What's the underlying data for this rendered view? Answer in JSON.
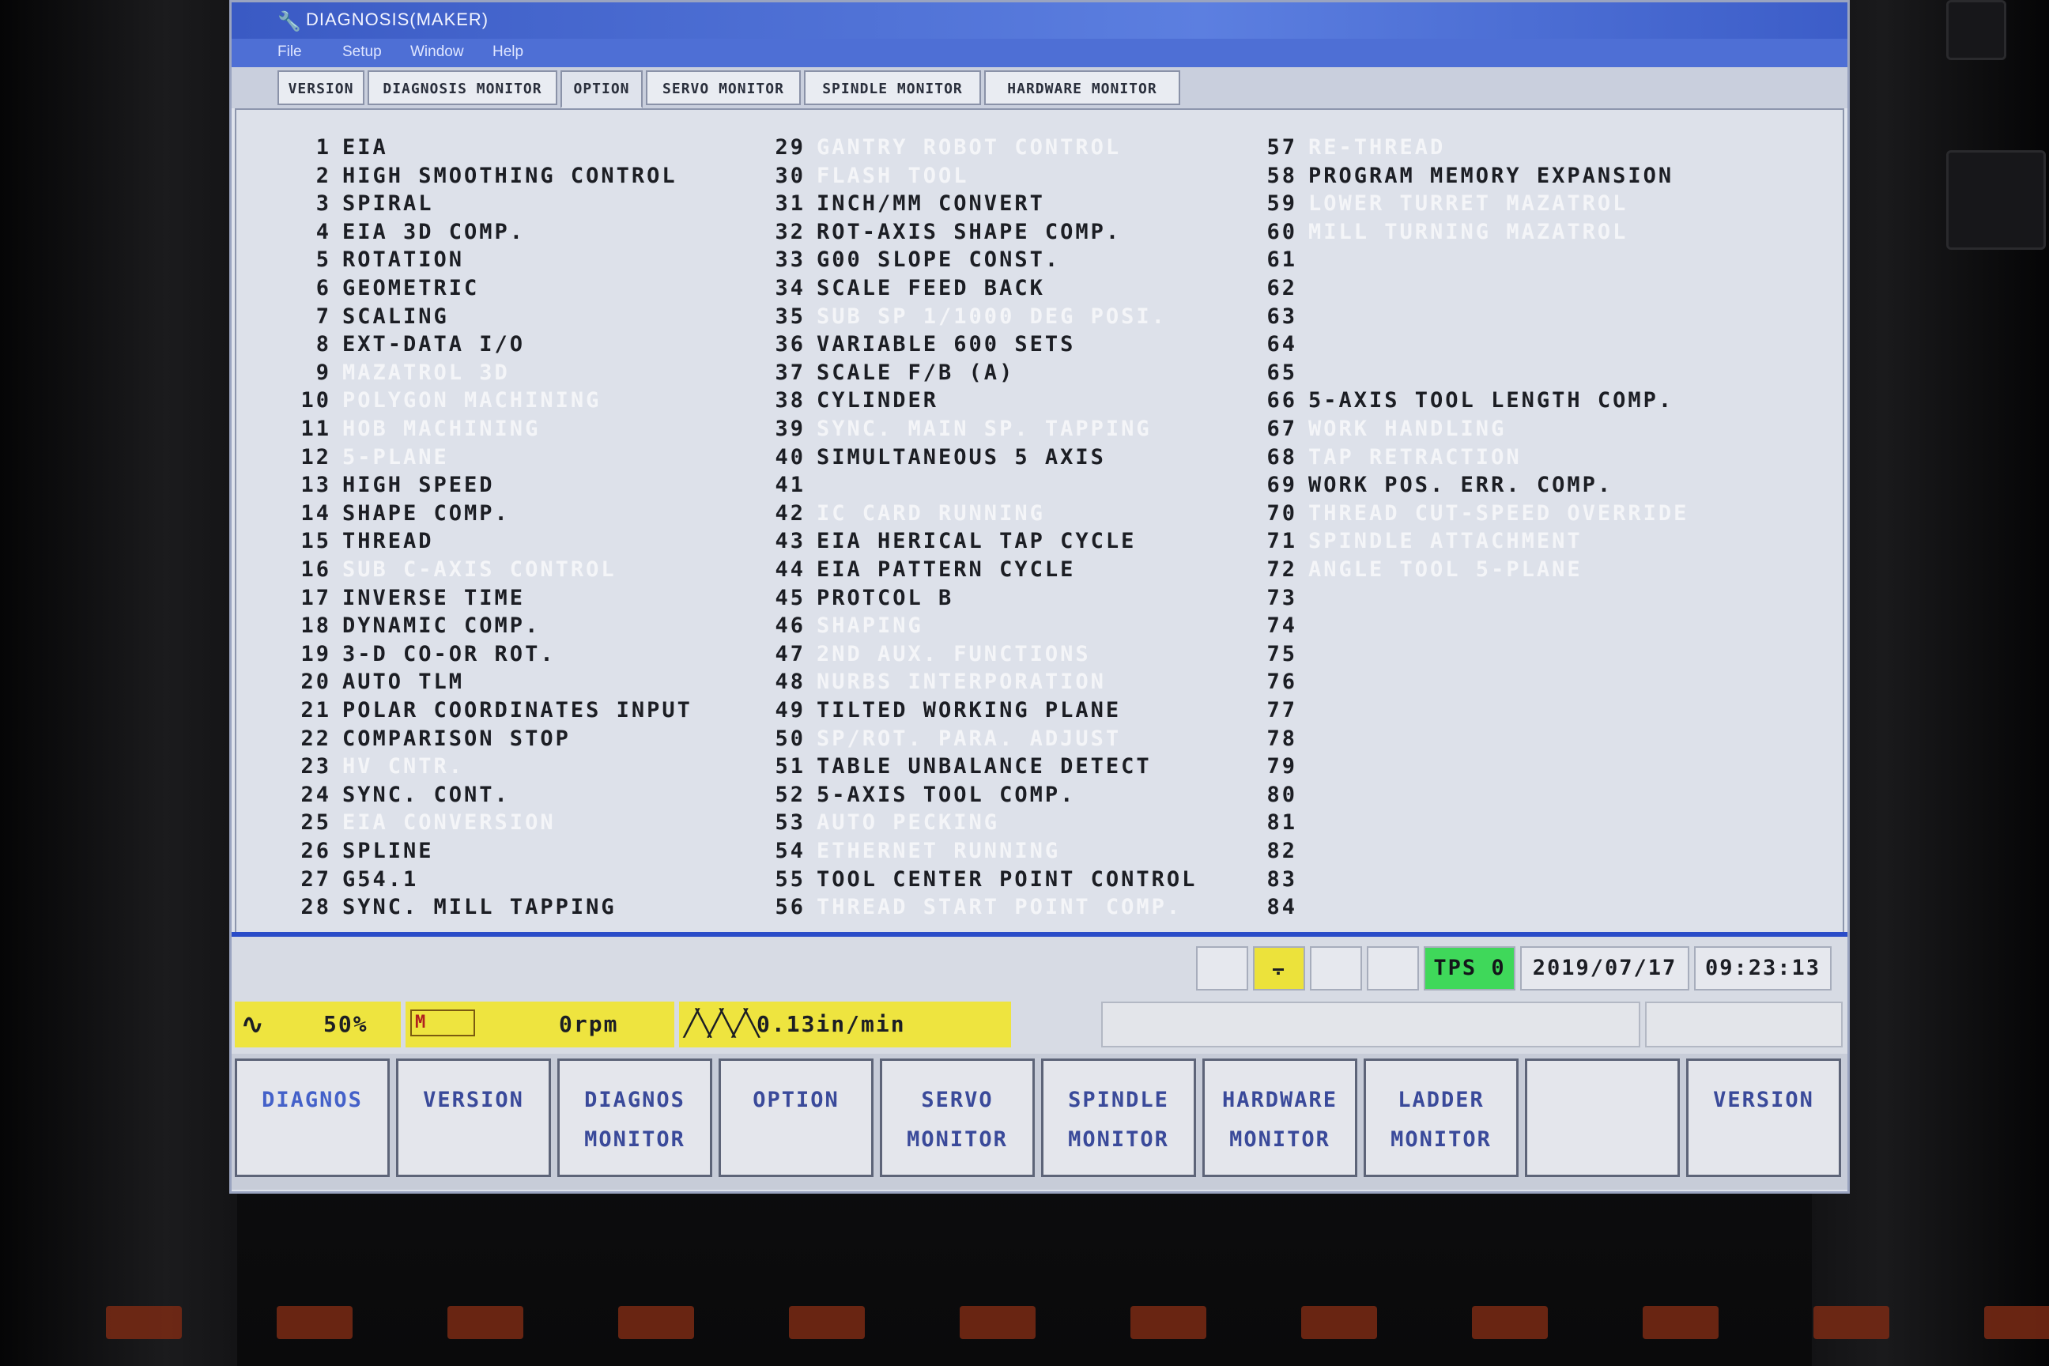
{
  "window": {
    "title": "DIAGNOSIS(MAKER)"
  },
  "menu": [
    "File",
    "Setup",
    "Window",
    "Help"
  ],
  "tabs": [
    "VERSION",
    "DIAGNOSIS MONITOR",
    "OPTION",
    "SERVO MONITOR",
    "SPINDLE MONITOR",
    "HARDWARE MONITOR"
  ],
  "active_tab": "OPTION",
  "options": [
    {
      "num": "1",
      "label": "EIA",
      "on": true
    },
    {
      "num": "2",
      "label": "HIGH SMOOTHING CONTROL",
      "on": true
    },
    {
      "num": "3",
      "label": "SPIRAL",
      "on": true
    },
    {
      "num": "4",
      "label": "EIA 3D COMP.",
      "on": true
    },
    {
      "num": "5",
      "label": "ROTATION",
      "on": true
    },
    {
      "num": "6",
      "label": "GEOMETRIC",
      "on": true
    },
    {
      "num": "7",
      "label": "SCALING",
      "on": true
    },
    {
      "num": "8",
      "label": "EXT-DATA I/O",
      "on": true
    },
    {
      "num": "9",
      "label": "MAZATROL 3D",
      "on": false
    },
    {
      "num": "10",
      "label": "POLYGON MACHINING",
      "on": false
    },
    {
      "num": "11",
      "label": "HOB MACHINING",
      "on": false
    },
    {
      "num": "12",
      "label": "5-PLANE",
      "on": false
    },
    {
      "num": "13",
      "label": "HIGH SPEED",
      "on": true
    },
    {
      "num": "14",
      "label": "SHAPE COMP.",
      "on": true
    },
    {
      "num": "15",
      "label": "THREAD",
      "on": true
    },
    {
      "num": "16",
      "label": "SUB C-AXIS CONTROL",
      "on": false
    },
    {
      "num": "17",
      "label": "INVERSE TIME",
      "on": true
    },
    {
      "num": "18",
      "label": "DYNAMIC COMP.",
      "on": true
    },
    {
      "num": "19",
      "label": "3-D CO-OR ROT.",
      "on": true
    },
    {
      "num": "20",
      "label": "AUTO TLM",
      "on": true
    },
    {
      "num": "21",
      "label": "POLAR COORDINATES INPUT",
      "on": true
    },
    {
      "num": "22",
      "label": "COMPARISON STOP",
      "on": true
    },
    {
      "num": "23",
      "label": "HV CNTR.",
      "on": false
    },
    {
      "num": "24",
      "label": "SYNC. CONT.",
      "on": true
    },
    {
      "num": "25",
      "label": "EIA CONVERSION",
      "on": false
    },
    {
      "num": "26",
      "label": "SPLINE",
      "on": true
    },
    {
      "num": "27",
      "label": "G54.1",
      "on": true
    },
    {
      "num": "28",
      "label": "SYNC. MILL TAPPING",
      "on": true
    },
    {
      "num": "29",
      "label": "GANTRY ROBOT CONTROL",
      "on": false
    },
    {
      "num": "30",
      "label": "FLASH TOOL",
      "on": false
    },
    {
      "num": "31",
      "label": "INCH/MM CONVERT",
      "on": true
    },
    {
      "num": "32",
      "label": "ROT-AXIS SHAPE COMP.",
      "on": true
    },
    {
      "num": "33",
      "label": "G00 SLOPE CONST.",
      "on": true
    },
    {
      "num": "34",
      "label": "SCALE FEED BACK",
      "on": true
    },
    {
      "num": "35",
      "label": "SUB SP 1/1000 DEG POSI.",
      "on": false
    },
    {
      "num": "36",
      "label": "VARIABLE 600 SETS",
      "on": true
    },
    {
      "num": "37",
      "label": "SCALE F/B (A)",
      "on": true
    },
    {
      "num": "38",
      "label": "CYLINDER",
      "on": true
    },
    {
      "num": "39",
      "label": "SYNC. MAIN SP. TAPPING",
      "on": false
    },
    {
      "num": "40",
      "label": "SIMULTANEOUS 5 AXIS",
      "on": true
    },
    {
      "num": "41",
      "label": "",
      "on": true
    },
    {
      "num": "42",
      "label": "IC CARD RUNNING",
      "on": false
    },
    {
      "num": "43",
      "label": "EIA HERICAL TAP CYCLE",
      "on": true
    },
    {
      "num": "44",
      "label": "EIA PATTERN CYCLE",
      "on": true
    },
    {
      "num": "45",
      "label": "PROTCOL B",
      "on": true
    },
    {
      "num": "46",
      "label": "SHAPING",
      "on": false
    },
    {
      "num": "47",
      "label": "2ND AUX. FUNCTIONS",
      "on": false
    },
    {
      "num": "48",
      "label": "NURBS INTERPORATION",
      "on": false
    },
    {
      "num": "49",
      "label": "TILTED WORKING PLANE",
      "on": true
    },
    {
      "num": "50",
      "label": "SP/ROT. PARA. ADJUST",
      "on": false
    },
    {
      "num": "51",
      "label": "TABLE UNBALANCE DETECT",
      "on": true
    },
    {
      "num": "52",
      "label": "5-AXIS TOOL COMP.",
      "on": true
    },
    {
      "num": "53",
      "label": "AUTO PECKING",
      "on": false
    },
    {
      "num": "54",
      "label": "ETHERNET RUNNING",
      "on": false
    },
    {
      "num": "55",
      "label": "TOOL CENTER POINT CONTROL",
      "on": true
    },
    {
      "num": "56",
      "label": "THREAD START POINT COMP.",
      "on": false
    },
    {
      "num": "57",
      "label": "RE-THREAD",
      "on": false
    },
    {
      "num": "58",
      "label": "PROGRAM MEMORY EXPANSION",
      "on": true
    },
    {
      "num": "59",
      "label": "LOWER TURRET MAZATROL",
      "on": false
    },
    {
      "num": "60",
      "label": "MILL TURNING MAZATROL",
      "on": false
    },
    {
      "num": "61",
      "label": "",
      "on": true
    },
    {
      "num": "62",
      "label": "",
      "on": true
    },
    {
      "num": "63",
      "label": "",
      "on": true
    },
    {
      "num": "64",
      "label": "",
      "on": true
    },
    {
      "num": "65",
      "label": "",
      "on": true
    },
    {
      "num": "66",
      "label": "5-AXIS TOOL LENGTH COMP.",
      "on": true
    },
    {
      "num": "67",
      "label": "WORK HANDLING",
      "on": false
    },
    {
      "num": "68",
      "label": "TAP RETRACTION",
      "on": false
    },
    {
      "num": "69",
      "label": "WORK POS. ERR. COMP.",
      "on": true
    },
    {
      "num": "70",
      "label": "THREAD CUT-SPEED OVERRIDE",
      "on": false
    },
    {
      "num": "71",
      "label": "SPINDLE ATTACHMENT",
      "on": false
    },
    {
      "num": "72",
      "label": "ANGLE TOOL 5-PLANE",
      "on": false
    },
    {
      "num": "73",
      "label": "",
      "on": true
    },
    {
      "num": "74",
      "label": "",
      "on": true
    },
    {
      "num": "75",
      "label": "",
      "on": true
    },
    {
      "num": "76",
      "label": "",
      "on": true
    },
    {
      "num": "77",
      "label": "",
      "on": true
    },
    {
      "num": "78",
      "label": "",
      "on": true
    },
    {
      "num": "79",
      "label": "",
      "on": true
    },
    {
      "num": "80",
      "label": "",
      "on": true
    },
    {
      "num": "81",
      "label": "",
      "on": true
    },
    {
      "num": "82",
      "label": "",
      "on": true
    },
    {
      "num": "83",
      "label": "",
      "on": true
    },
    {
      "num": "84",
      "label": "",
      "on": true
    }
  ],
  "status": {
    "tps": "TPS 0",
    "date": "2019/07/17",
    "time": "09:23:13"
  },
  "info": {
    "override": "50%",
    "spindle": "0rpm",
    "feed": "0.13in/min",
    "spindle_icon_label": "M"
  },
  "softkeys": [
    {
      "l1": "DIAGNOS",
      "l2": ""
    },
    {
      "l1": "VERSION",
      "l2": ""
    },
    {
      "l1": "DIAGNOS",
      "l2": "MONITOR"
    },
    {
      "l1": "OPTION",
      "l2": ""
    },
    {
      "l1": "SERVO",
      "l2": "MONITOR"
    },
    {
      "l1": "SPINDLE",
      "l2": "MONITOR"
    },
    {
      "l1": "HARDWARE",
      "l2": "MONITOR"
    },
    {
      "l1": "LADDER",
      "l2": "MONITOR"
    },
    {
      "l1": "",
      "l2": ""
    },
    {
      "l1": "VERSION",
      "l2": ""
    }
  ],
  "colors": {
    "title_bar": "#4a6ad8",
    "tps_green": "#3fd85a",
    "info_yellow": "#eee43f",
    "disabled_text": "#f4f5f8",
    "enabled_text": "#1c1e24",
    "softkey_text": "#3a4a9a"
  },
  "icons": {
    "title": "wrench-icon",
    "tool": "tool-holder-icon",
    "override": "sine-wave-icon",
    "spindle": "spindle-motor-icon",
    "feed": "zigzag-feed-icon"
  }
}
